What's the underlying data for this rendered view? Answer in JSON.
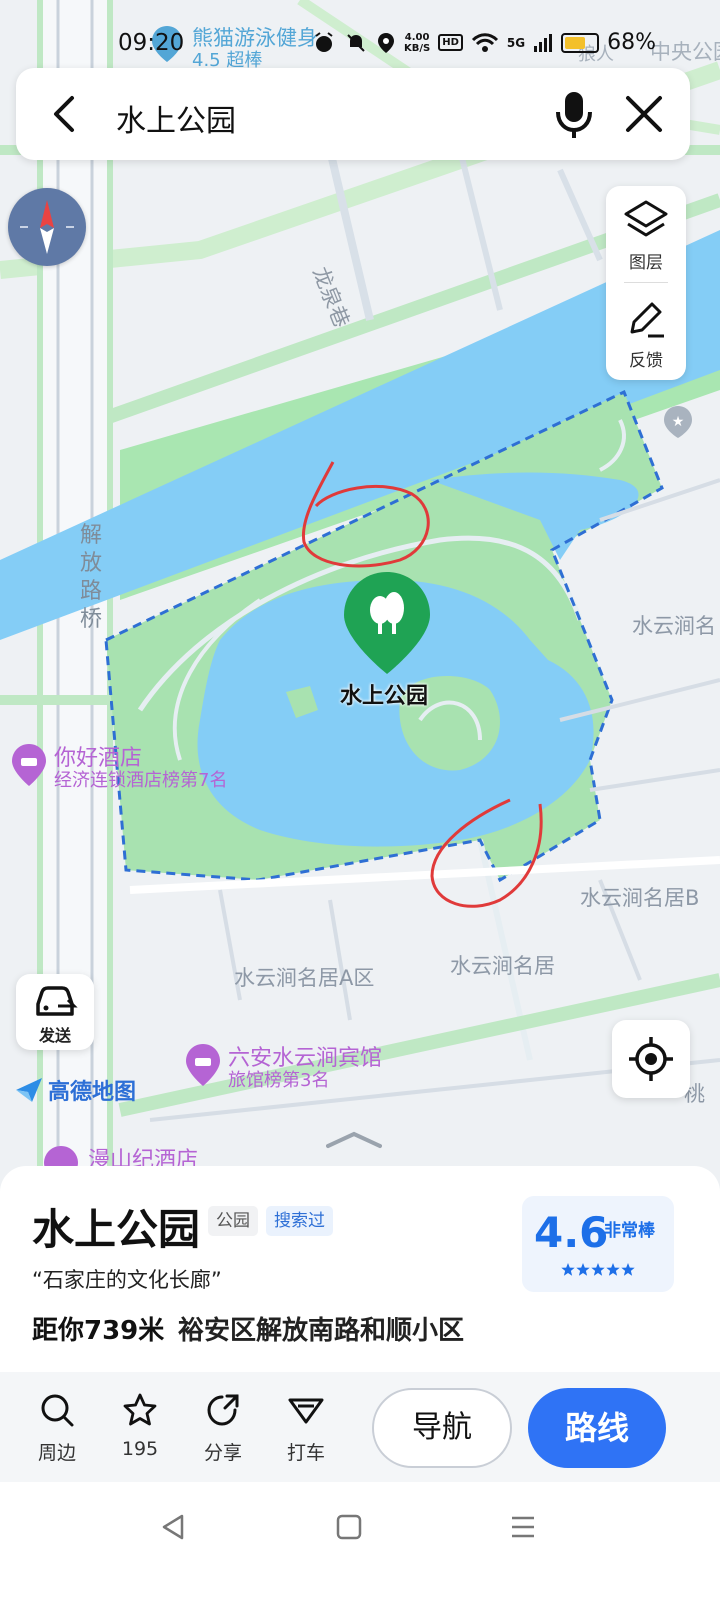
{
  "status_bar": {
    "time": "09:20",
    "net_speed": "4.00",
    "net_unit": "KB/S",
    "hd": "HD",
    "signal": "5G",
    "battery_text": "68%",
    "battery_level": 0.68
  },
  "search": {
    "query": "水上公园"
  },
  "map": {
    "top_poi_name": "熊猫游泳健身",
    "top_poi_sub": "4.5 超棒",
    "top_right_partial": "中央公园",
    "top_right_partial2": "狼人",
    "street_longquan": "龙泉巷",
    "street_jiefang": "解放路桥",
    "right_label": "水云涧名",
    "marker_name": "水上公园",
    "hotel1_name": "你好酒店",
    "hotel1_sub": "经济连锁酒店榜第7名",
    "label_shuiyun_right": "水云涧名居B",
    "label_shuiyun_a": "水云涧名居A区",
    "label_shuiyun": "水云涧名居",
    "hotel2_name": "六安水云涧宾馆",
    "hotel2_sub": "旅馆榜第3名",
    "hotel3_name": "漫山纪酒店",
    "right_partial_tao": "桃"
  },
  "tools": {
    "layers_label": "图层",
    "feedback_label": "反馈"
  },
  "send_label": "发送",
  "brand": "高德地图",
  "place": {
    "name": "水上公园",
    "type_chip": "公园",
    "searched_chip": "搜索过",
    "quote": "“石家庄的文化长廊”",
    "distance": "距你739米",
    "address": "裕安区解放南路和顺小区",
    "rating": "4.6",
    "rating_desc": "非常棒",
    "stars": 4.6
  },
  "actions": {
    "nearby": "周边",
    "favorites_count": "195",
    "share": "分享",
    "taxi": "打车",
    "navigate": "导航",
    "route": "路线"
  },
  "colors": {
    "water": "#84cdf6",
    "park": "#a8e2b0",
    "boundary": "#2e6fd4",
    "marker": "#1fa354",
    "annotation": "#e03a3a",
    "primary": "#2f73f5"
  }
}
